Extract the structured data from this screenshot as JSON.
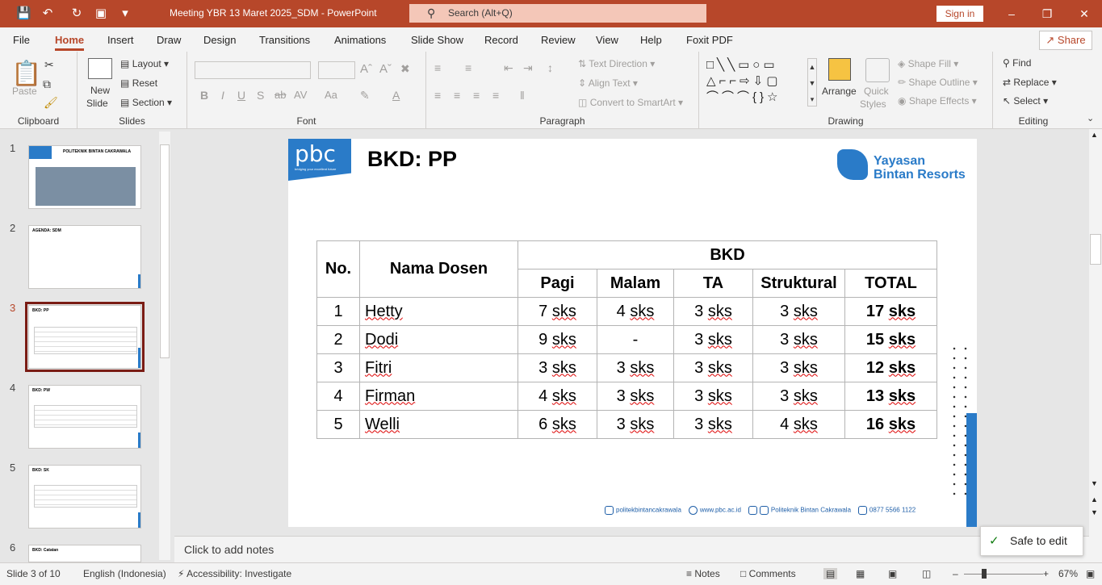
{
  "app": {
    "doc_title": "Meeting YBR 13 Maret 2025_SDM  -  PowerPoint",
    "search_placeholder": "Search (Alt+Q)",
    "sign_in": "Sign in",
    "share": "Share"
  },
  "tabs": [
    "File",
    "Home",
    "Insert",
    "Draw",
    "Design",
    "Transitions",
    "Animations",
    "Slide Show",
    "Record",
    "Review",
    "View",
    "Help",
    "Foxit PDF"
  ],
  "active_tab": "Home",
  "ribbon": {
    "clipboard": {
      "label": "Clipboard",
      "paste": "Paste"
    },
    "slides": {
      "label": "Slides",
      "new_slide": "New",
      "new_slide2": "Slide",
      "layout": "Layout",
      "reset": "Reset",
      "section": "Section"
    },
    "font": {
      "label": "Font"
    },
    "paragraph": {
      "label": "Paragraph",
      "text_direction": "Text Direction",
      "align_text": "Align Text",
      "convert": "Convert to SmartArt"
    },
    "drawing": {
      "label": "Drawing",
      "arrange": "Arrange",
      "quick": "Quick",
      "styles": "Styles",
      "shape_fill": "Shape Fill",
      "shape_outline": "Shape Outline",
      "shape_effects": "Shape Effects"
    },
    "editing": {
      "label": "Editing",
      "find": "Find",
      "replace": "Replace",
      "select": "Select"
    }
  },
  "thumbnails": [
    {
      "num": "1",
      "title": "POLITEKNIK BINTAN CAKRAWALA"
    },
    {
      "num": "2",
      "title": "AGENDA: SDM"
    },
    {
      "num": "3",
      "title": "BKD: PP"
    },
    {
      "num": "4",
      "title": "BKD: PW"
    },
    {
      "num": "5",
      "title": "BKD: SK"
    },
    {
      "num": "6",
      "title": "BKD: Catatan"
    }
  ],
  "slide": {
    "title": "BKD: PP",
    "logo_left": "pbc",
    "logo_left_tag": "bridging your excellent future",
    "logo_right_1": "Yayasan",
    "logo_right_2": "Bintan Resorts",
    "table": {
      "h_no": "No.",
      "h_name": "Nama Dosen",
      "h_group": "BKD",
      "cols": [
        "Pagi",
        "Malam",
        "TA",
        "Struktural",
        "TOTAL"
      ],
      "rows": [
        [
          "1",
          "Hetty",
          "7 sks",
          "4 sks",
          "3 sks",
          "3 sks",
          "17 sks"
        ],
        [
          "2",
          "Dodi",
          "9 sks",
          "-",
          "3 sks",
          "3 sks",
          "15 sks"
        ],
        [
          "3",
          "Fitri",
          "3 sks",
          "3 sks",
          "3 sks",
          "3 sks",
          "12 sks"
        ],
        [
          "4",
          "Firman",
          "4 sks",
          "3 sks",
          "3 sks",
          "3 sks",
          "13 sks"
        ],
        [
          "5",
          "Welli",
          "6 sks",
          "3 sks",
          "3 sks",
          "4 sks",
          "16 sks"
        ]
      ]
    },
    "footer": {
      "ig": "politekbintancakrawala",
      "web": "www.pbc.ac.id",
      "fb": "Politeknik Bintan Cakrawala",
      "phone": "0877 5566 1122"
    }
  },
  "notes_placeholder": "Click to add notes",
  "status": {
    "slide": "Slide 3 of 10",
    "language": "English (Indonesia)",
    "accessibility": "Accessibility: Investigate",
    "notes": "Notes",
    "comments": "Comments",
    "zoom": "67%"
  },
  "toast": "Safe to edit"
}
